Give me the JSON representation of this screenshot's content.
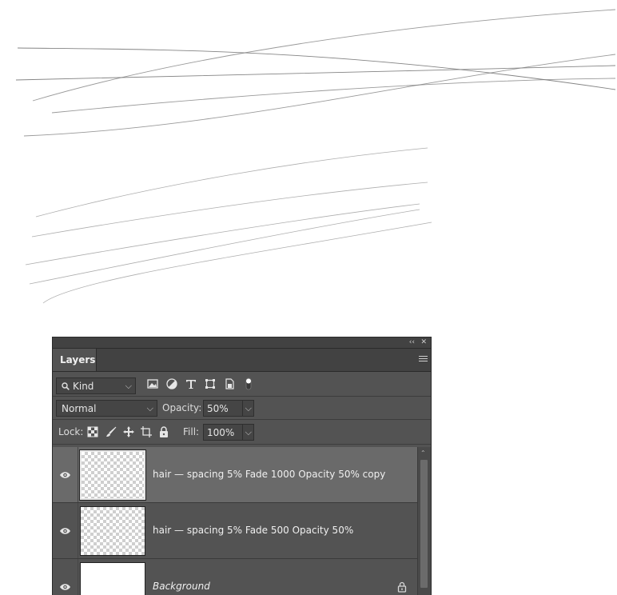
{
  "panel": {
    "collapse_glyph": "‹‹",
    "close_glyph": "✕",
    "tab_label": "Layers"
  },
  "filter": {
    "kind_label": "Kind",
    "icons": [
      "image-filter-icon",
      "adjustment-filter-icon",
      "type-filter-icon",
      "shape-filter-icon",
      "smart-object-filter-icon",
      "filter-toggle-icon"
    ]
  },
  "blend": {
    "mode": "Normal",
    "opacity_label": "Opacity:",
    "opacity_value": "50%"
  },
  "lock": {
    "label": "Lock:",
    "fill_label": "Fill:",
    "fill_value": "100%"
  },
  "layers": [
    {
      "name": "hair — spacing 5% Fade 1000 Opacity 50% copy",
      "selected": true
    },
    {
      "name": "hair — spacing 5% Fade 500 Opacity 50%",
      "selected": false
    },
    {
      "name": "Background",
      "selected": false,
      "locked": true
    }
  ],
  "colors": {
    "panel_bg": "#535353",
    "selected_layer": "#6a6a6a",
    "stroke": "#555555"
  }
}
